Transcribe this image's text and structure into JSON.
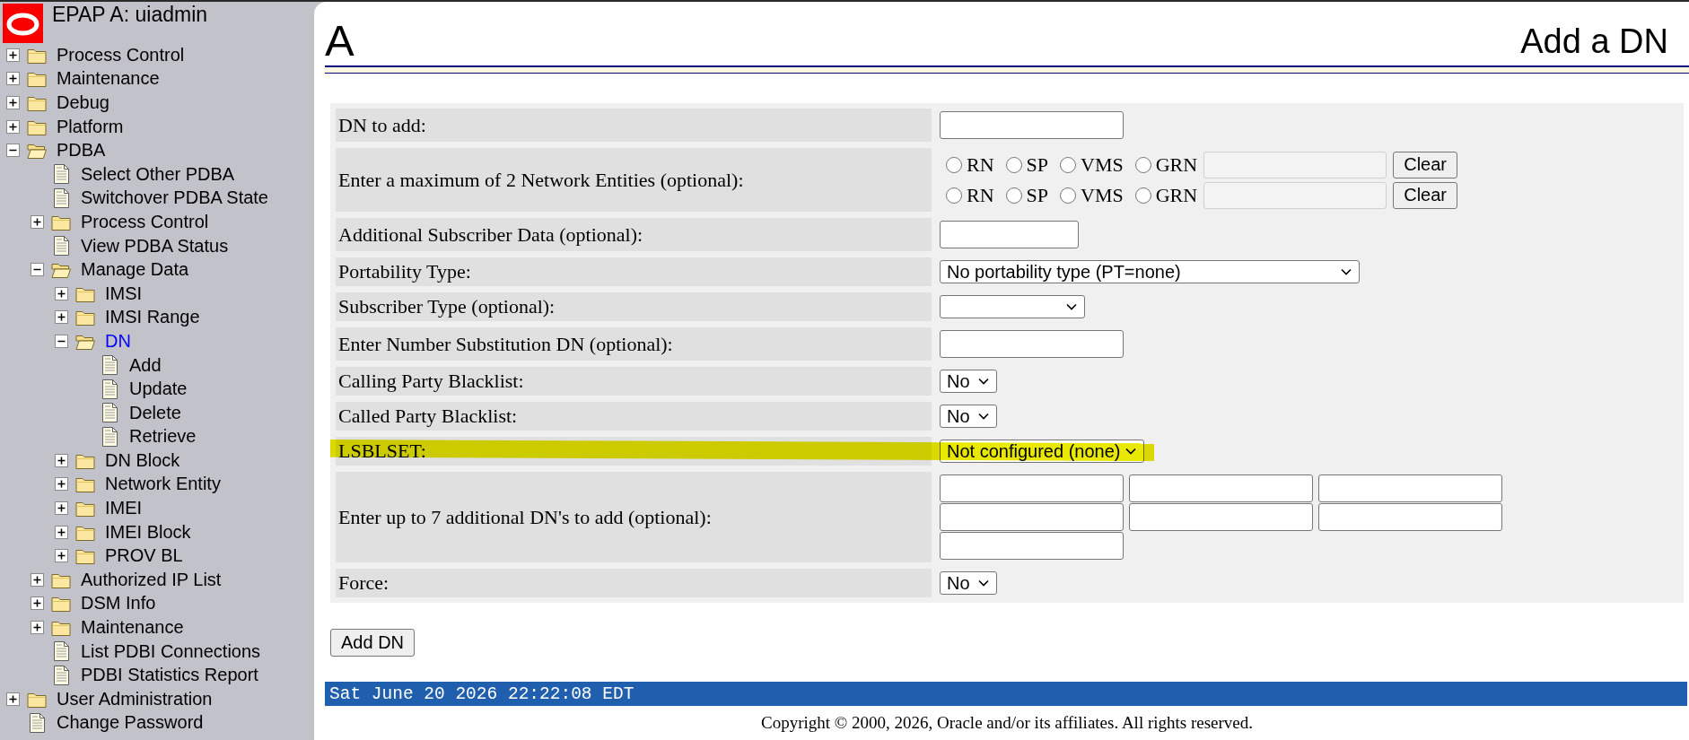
{
  "sidebar": {
    "title": "EPAP A: uiadmin",
    "tree": [
      {
        "label": "Process Control",
        "kind": "folder",
        "expanded": false,
        "selected": false
      },
      {
        "label": "Maintenance",
        "kind": "folder",
        "expanded": false,
        "selected": false
      },
      {
        "label": "Debug",
        "kind": "folder",
        "expanded": false,
        "selected": false
      },
      {
        "label": "Platform",
        "kind": "folder",
        "expanded": false,
        "selected": false
      },
      {
        "label": "PDBA",
        "kind": "folder",
        "expanded": true,
        "selected": false,
        "children": [
          {
            "label": "Select Other PDBA",
            "kind": "page",
            "selected": false
          },
          {
            "label": "Switchover PDBA State",
            "kind": "page",
            "selected": false
          },
          {
            "label": "Process Control",
            "kind": "folder",
            "expanded": false,
            "selected": false
          },
          {
            "label": "View PDBA Status",
            "kind": "page",
            "selected": false
          },
          {
            "label": "Manage Data",
            "kind": "folder",
            "expanded": true,
            "selected": false,
            "children": [
              {
                "label": "IMSI",
                "kind": "folder",
                "expanded": false,
                "selected": false
              },
              {
                "label": "IMSI Range",
                "kind": "folder",
                "expanded": false,
                "selected": false
              },
              {
                "label": "DN",
                "kind": "folder",
                "expanded": true,
                "selected": true,
                "children": [
                  {
                    "label": "Add",
                    "kind": "page",
                    "selected": false
                  },
                  {
                    "label": "Update",
                    "kind": "page",
                    "selected": false
                  },
                  {
                    "label": "Delete",
                    "kind": "page",
                    "selected": false
                  },
                  {
                    "label": "Retrieve",
                    "kind": "page",
                    "selected": false
                  }
                ]
              },
              {
                "label": "DN Block",
                "kind": "folder",
                "expanded": false,
                "selected": false
              },
              {
                "label": "Network Entity",
                "kind": "folder",
                "expanded": false,
                "selected": false
              },
              {
                "label": "IMEI",
                "kind": "folder",
                "expanded": false,
                "selected": false
              },
              {
                "label": "IMEI Block",
                "kind": "folder",
                "expanded": false,
                "selected": false
              },
              {
                "label": "PROV BL",
                "kind": "folder",
                "expanded": false,
                "selected": false
              }
            ]
          },
          {
            "label": "Authorized IP List",
            "kind": "folder",
            "expanded": false,
            "selected": false
          },
          {
            "label": "DSM Info",
            "kind": "folder",
            "expanded": false,
            "selected": false
          },
          {
            "label": "Maintenance",
            "kind": "folder",
            "expanded": false,
            "selected": false
          },
          {
            "label": "List PDBI Connections",
            "kind": "page",
            "selected": false
          },
          {
            "label": "PDBI Statistics Report",
            "kind": "page",
            "selected": false
          }
        ]
      },
      {
        "label": "User Administration",
        "kind": "folder",
        "expanded": false,
        "selected": false
      },
      {
        "label": "Change Password",
        "kind": "page",
        "selected": false
      }
    ]
  },
  "header": {
    "area": "A",
    "title": "Add a DN"
  },
  "form": {
    "rows": [
      {
        "label": "DN to add:",
        "kind": "text",
        "disabled": false,
        "highlighted": false
      },
      {
        "label": "Enter a maximum of 2 Network Entities (optional):",
        "kind": "entities",
        "highlighted": false,
        "entities": [
          {
            "options": [
              {
                "label": "RN",
                "selected": false
              },
              {
                "label": "SP",
                "selected": false
              },
              {
                "label": "VMS",
                "selected": false
              },
              {
                "label": "GRN",
                "selected": false
              }
            ],
            "field": {
              "disabled": true
            },
            "clear_button": "Clear"
          },
          {
            "options": [
              {
                "label": "RN",
                "selected": false
              },
              {
                "label": "SP",
                "selected": false
              },
              {
                "label": "VMS",
                "selected": false
              },
              {
                "label": "GRN",
                "selected": false
              }
            ],
            "field": {
              "disabled": true
            },
            "clear_button": "Clear"
          }
        ]
      },
      {
        "label": "Additional Subscriber Data (optional):",
        "kind": "text",
        "disabled": false,
        "highlighted": false
      },
      {
        "label": "Portability Type:",
        "kind": "select",
        "value": "No portability type (PT=none)",
        "highlighted": false
      },
      {
        "label": "Subscriber Type (optional):",
        "kind": "select",
        "highlighted": false
      },
      {
        "label": "Enter Number Substitution DN (optional):",
        "kind": "text",
        "disabled": false,
        "highlighted": false
      },
      {
        "label": "Calling Party Blacklist:",
        "kind": "select",
        "value": "No",
        "highlighted": false
      },
      {
        "label": "Called Party Blacklist:",
        "kind": "select",
        "value": "No",
        "highlighted": false
      },
      {
        "label": "LSBLSET:",
        "kind": "select",
        "value": "Not configured (none)",
        "highlighted": true
      },
      {
        "label": "Enter up to 7 additional DN's to add (optional):",
        "kind": "textgrid",
        "highlighted": false,
        "fields": [
          {
            "disabled": false
          },
          {
            "disabled": false
          },
          {
            "disabled": false
          },
          {
            "disabled": false
          },
          {
            "disabled": false
          },
          {
            "disabled": false
          },
          {
            "disabled": false
          }
        ]
      },
      {
        "label": "Force:",
        "kind": "select",
        "value": "No",
        "highlighted": false
      }
    ]
  },
  "submit_button": "Add DN",
  "status_bar": {
    "datetime": "Sat June 20 2026 22:22:08 EDT"
  },
  "footer": {
    "copyright": "Copyright © 2000, 2026, Oracle and/or its affiliates. All rights reserved."
  }
}
